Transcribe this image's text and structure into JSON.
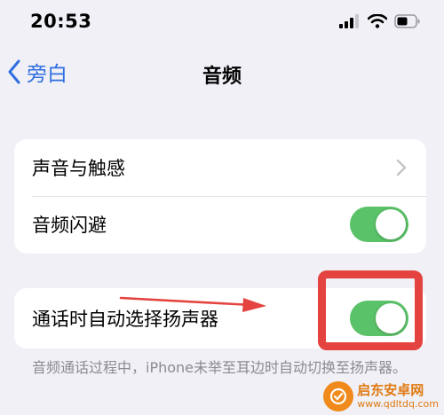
{
  "status_bar": {
    "time": "20:53",
    "icons": [
      "cellular-signal-icon",
      "wifi-icon",
      "battery-icon"
    ]
  },
  "nav": {
    "back_label": "旁白",
    "title": "音频"
  },
  "group1": {
    "rows": [
      {
        "label": "声音与触感",
        "accessory": "chevron"
      },
      {
        "label": "音频闪避",
        "accessory": "toggle",
        "value": "on"
      }
    ]
  },
  "group2": {
    "rows": [
      {
        "label": "通话时自动选择扬声器",
        "accessory": "toggle",
        "value": "on"
      }
    ]
  },
  "footer_note": "音频通话过程中，iPhone未举至耳边时自动切换至扬声器。",
  "watermark": {
    "title": "启东安卓网",
    "url": "www.qdltdq.com"
  },
  "colors": {
    "accent": "#2f6fe0",
    "toggle_on": "#5ac268",
    "highlight": "#e5433f",
    "background": "#f0f0f6"
  }
}
